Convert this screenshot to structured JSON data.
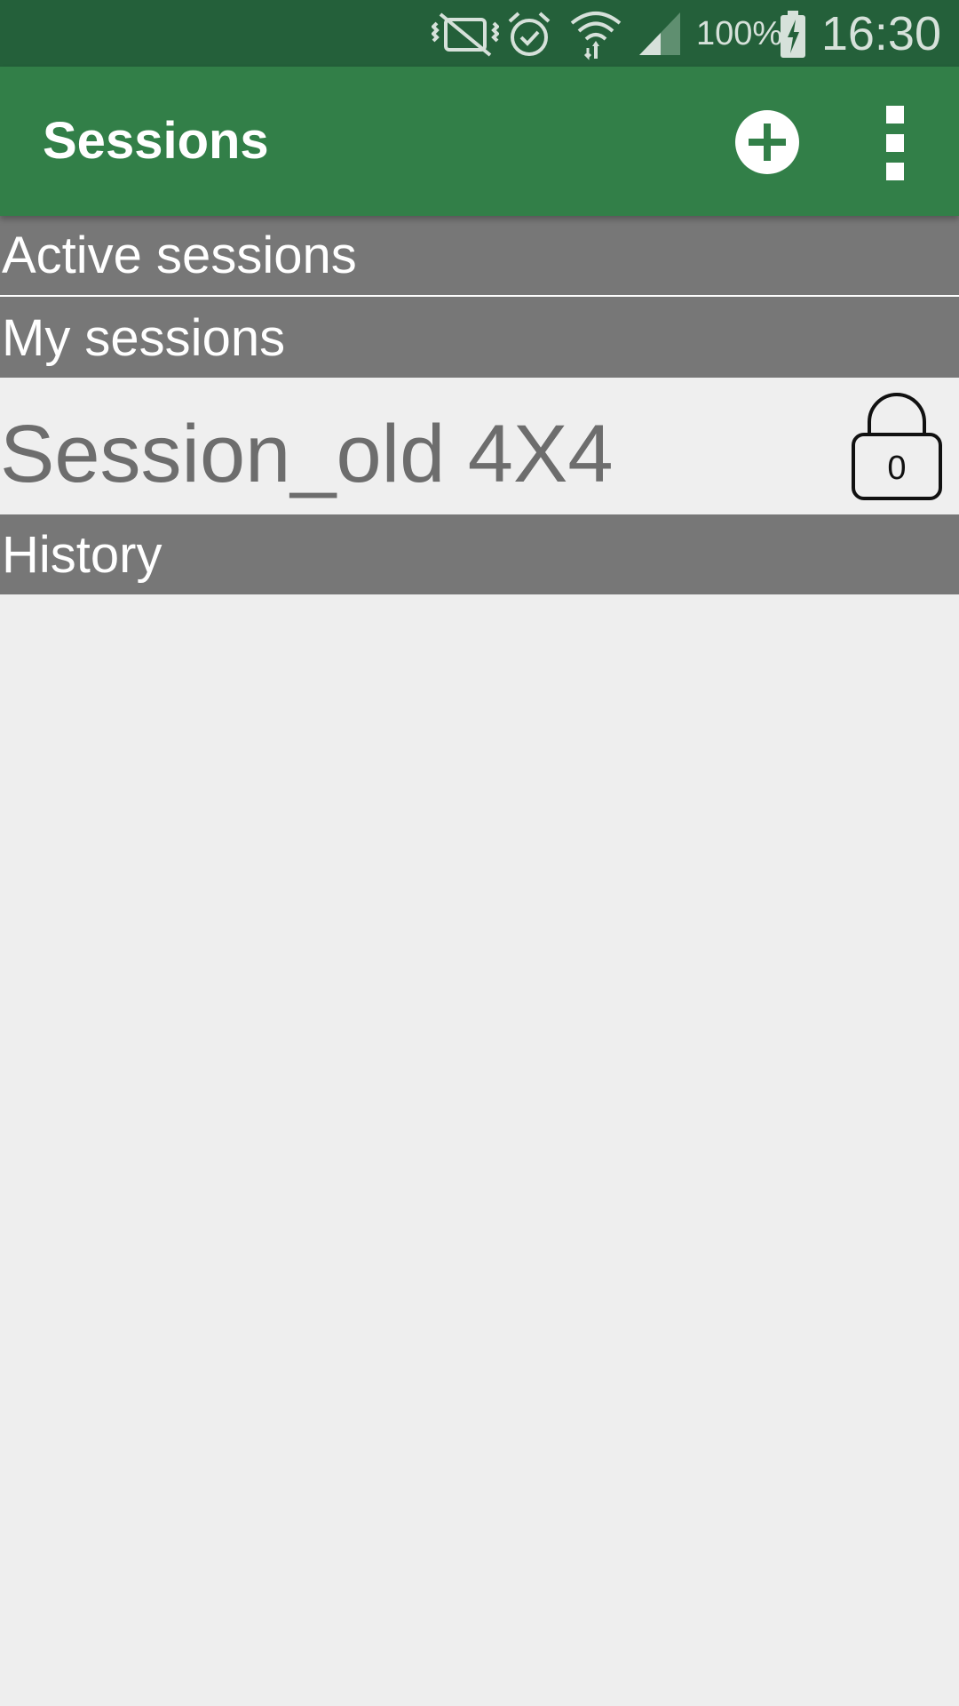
{
  "status_bar": {
    "battery_percent": "100%",
    "time": "16:30",
    "icons": [
      "vibrate-mute-icon",
      "alarm-icon",
      "wifi-icon",
      "signal-icon",
      "battery-charging-icon"
    ]
  },
  "app_bar": {
    "title": "Sessions",
    "actions": [
      "add-circle-icon",
      "more-vertical-icon"
    ]
  },
  "sections": {
    "active": {
      "label": "Active sessions"
    },
    "my": {
      "label": "My sessions",
      "items": [
        {
          "name": "Session_old 4X4",
          "lock_count": "0",
          "icon": "lock-icon"
        }
      ]
    },
    "history": {
      "label": "History"
    }
  },
  "colors": {
    "status_bar": "#24603a",
    "app_bar": "#327f48",
    "section_header": "#777777",
    "background": "#eeeeee"
  }
}
